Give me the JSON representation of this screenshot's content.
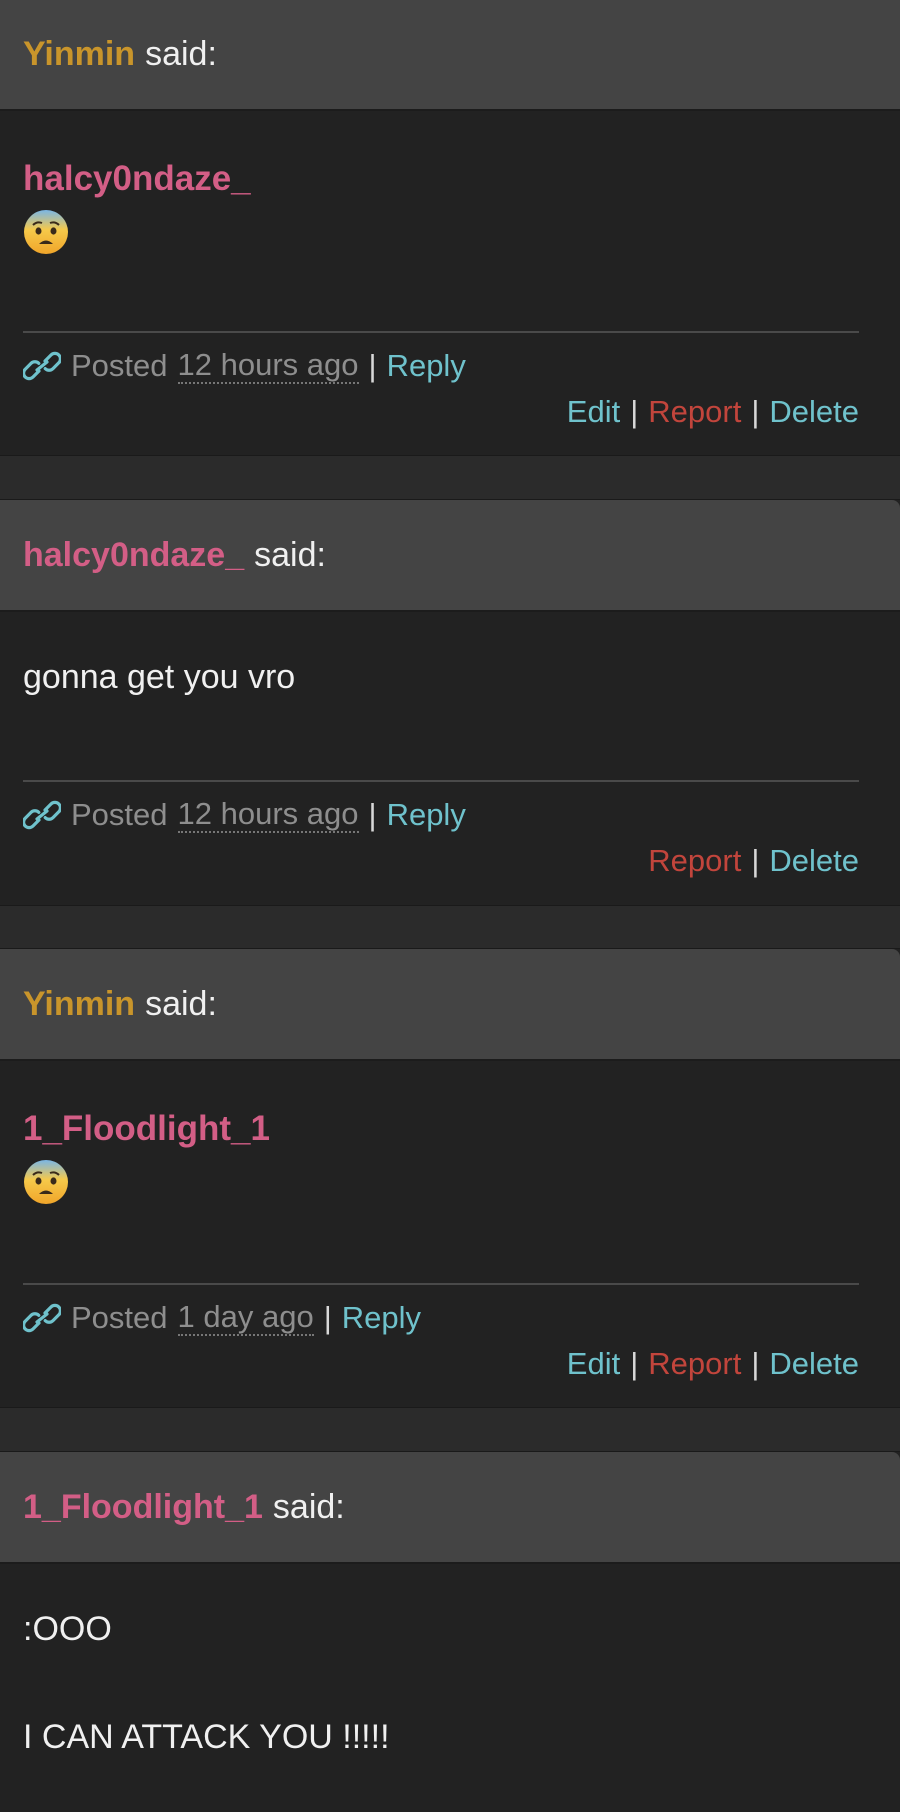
{
  "colors": {
    "gold_user": "#c9952b",
    "pink_user": "#d35e86",
    "teal_link": "#6fc2cc",
    "red_link": "#c2453c"
  },
  "comments": [
    {
      "author": "Yinmin",
      "said": "said:",
      "mention": "halcy0ndaze_",
      "emoji": "fearful-face",
      "posted_label": "Posted",
      "time_ago": "12 hours ago",
      "reply": "Reply",
      "edit": "Edit",
      "report": "Report",
      "delete": "Delete"
    },
    {
      "author": "halcy0ndaze_",
      "said": "said:",
      "text": "gonna get you vro",
      "posted_label": "Posted",
      "time_ago": "12 hours ago",
      "reply": "Reply",
      "report": "Report",
      "delete": "Delete"
    },
    {
      "author": "Yinmin",
      "said": "said:",
      "mention": "1_Floodlight_1",
      "emoji": "fearful-face",
      "posted_label": "Posted",
      "time_ago": "1 day ago",
      "reply": "Reply",
      "edit": "Edit",
      "report": "Report",
      "delete": "Delete"
    },
    {
      "author": "1_Floodlight_1",
      "said": "said:",
      "text_line1": ":OOO",
      "text_line2": "I CAN ATTACK YOU !!!!!"
    }
  ]
}
